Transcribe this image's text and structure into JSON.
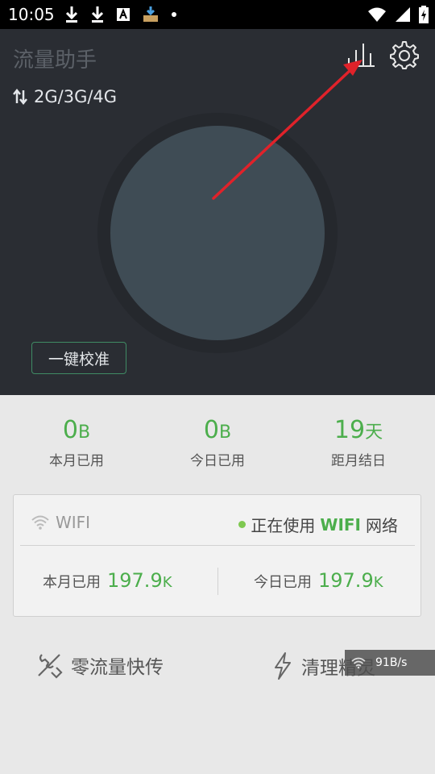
{
  "status_bar": {
    "time": "10:05"
  },
  "app": {
    "title": "流量助手"
  },
  "network": {
    "type_label": "2G/3G/4G"
  },
  "calibrate": {
    "label": "一键校准"
  },
  "stats": [
    {
      "value": "0",
      "unit": "B",
      "label": "本月已用"
    },
    {
      "value": "0",
      "unit": "B",
      "label": "今日已用"
    },
    {
      "value": "19",
      "unit": "天",
      "label": "距月结日"
    }
  ],
  "wifi": {
    "label": "WIFI",
    "status_prefix": "正在使用",
    "status_highlight": "WIFI",
    "status_suffix": "网络",
    "month_label": "本月已用",
    "month_value": "197.9",
    "month_unit": "K",
    "today_label": "今日已用",
    "today_value": "197.9",
    "today_unit": "K"
  },
  "tools": {
    "zero_transfer": "零流量快传",
    "cleaner": "清理精灵"
  },
  "speed": {
    "value": "91B/s"
  },
  "colors": {
    "accent_green": "#4cae4c",
    "header_bg": "#2a2d33",
    "arrow_red": "#e0222a"
  }
}
